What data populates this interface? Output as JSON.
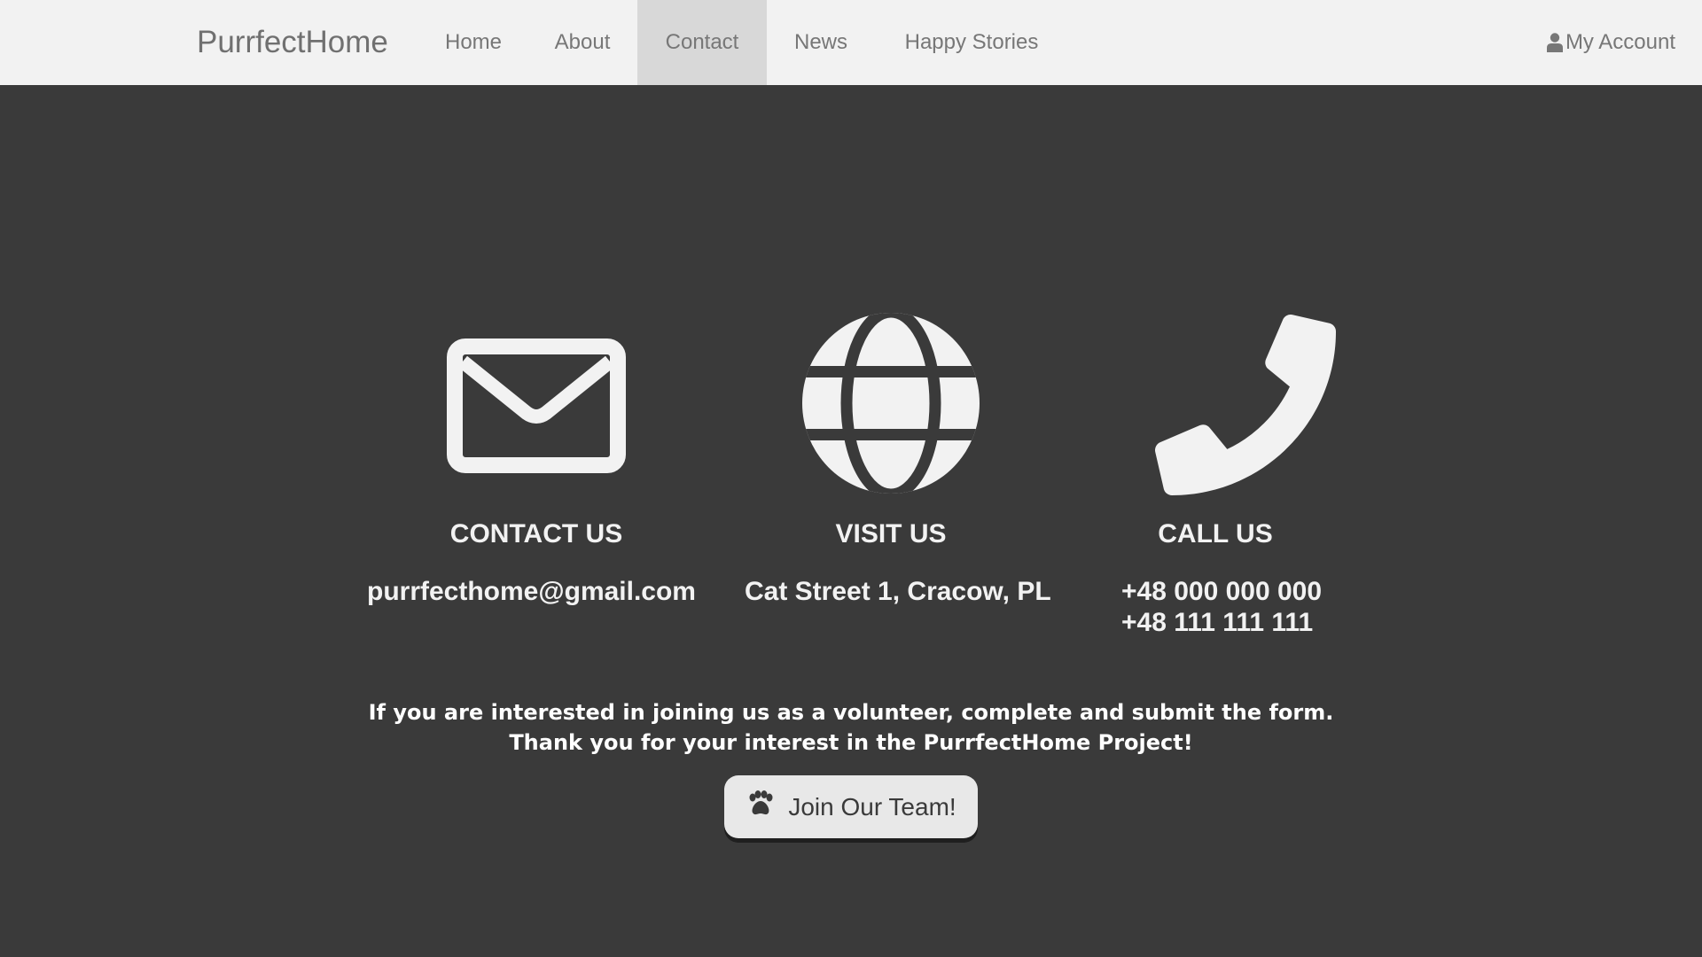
{
  "navbar": {
    "brand": "PurrfectHome",
    "items": [
      {
        "label": "Home",
        "active": false
      },
      {
        "label": "About",
        "active": false
      },
      {
        "label": "Contact",
        "active": true
      },
      {
        "label": "News",
        "active": false
      },
      {
        "label": "Happy Stories",
        "active": false
      }
    ],
    "account": {
      "label": "My Account",
      "icon": "user-icon"
    }
  },
  "contact": {
    "email": {
      "icon": "envelope-icon",
      "title": "CONTACT US",
      "value": "purrfecthome@gmail.com"
    },
    "visit": {
      "icon": "globe-icon",
      "title": "VISIT US",
      "value": "Cat Street 1, Cracow, PL"
    },
    "call": {
      "icon": "phone-icon",
      "title": "CALL US",
      "phones": [
        "+48 000 000 000",
        "+48 111 111 111"
      ]
    }
  },
  "volunteer": {
    "line1": "If you are interested in joining us as a volunteer, complete and submit the form.",
    "line2": "Thank you for your interest in the PurrfectHome Project!",
    "button_label": "Join Our Team!",
    "button_icon": "paw-icon"
  },
  "colors": {
    "navbar_bg": "#f2f2f2",
    "active_tab_bg": "#d8d8d8",
    "page_bg": "#3a3a3a",
    "text_light": "#f2f2f2",
    "button_bg": "#e8e8e8"
  }
}
